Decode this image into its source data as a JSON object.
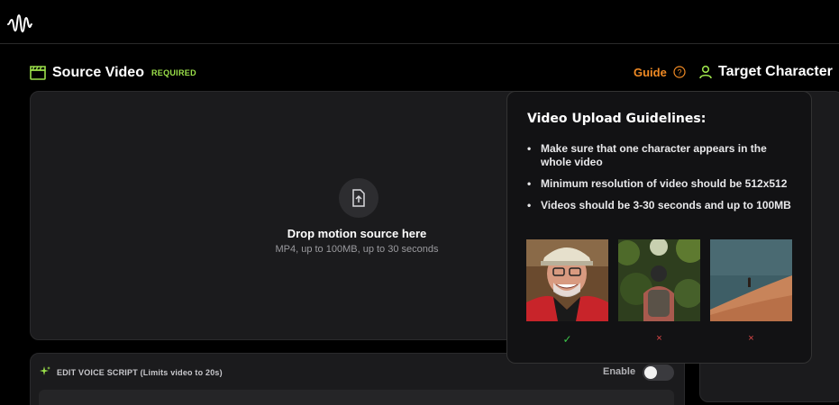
{
  "header": {
    "logo_icon": "waveform-logo-icon"
  },
  "source": {
    "title": "Source Video",
    "required_badge": "REQUIRED",
    "icon": "clapperboard-icon",
    "accent_color": "#9be04a"
  },
  "guide": {
    "label": "Guide",
    "color": "#f08a24",
    "icon": "help-circle-icon"
  },
  "target": {
    "title": "Target Character",
    "icon": "person-icon"
  },
  "dropzone": {
    "icon": "file-upload-icon",
    "title": "Drop motion source here",
    "subtitle": "MP4, up to 100MB, up to 30 seconds"
  },
  "voice": {
    "label": "EDIT VOICE SCRIPT (Limits video to 20s)",
    "enable_label": "Enable",
    "enabled": false,
    "placeholder": ""
  },
  "popover": {
    "title": "Video Upload Guidelines:",
    "items": [
      "Make sure that one character appears in the whole video",
      "Minimum resolution of video should be 512x512",
      "Videos should be 3-30 seconds and up to 100MB"
    ],
    "examples": [
      {
        "subject": "smiling man in cap close-up",
        "verdict": "good",
        "mark": "✓"
      },
      {
        "subject": "hiker seen from behind in forest",
        "verdict": "bad",
        "mark": "×"
      },
      {
        "subject": "tiny figure on distant sand dune",
        "verdict": "bad",
        "mark": "×"
      }
    ]
  }
}
